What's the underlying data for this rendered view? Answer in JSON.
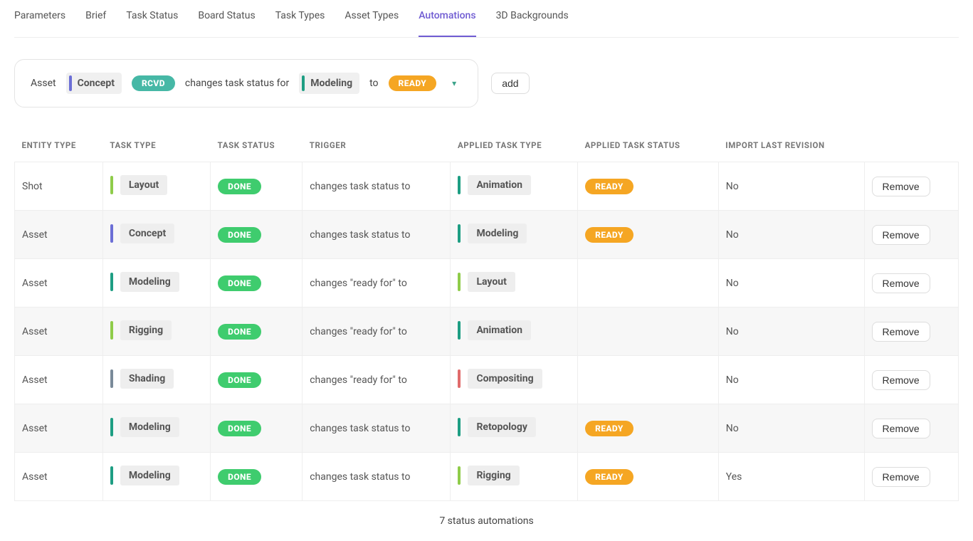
{
  "tabs": [
    {
      "label": "Parameters",
      "active": false
    },
    {
      "label": "Brief",
      "active": false
    },
    {
      "label": "Task Status",
      "active": false
    },
    {
      "label": "Board Status",
      "active": false
    },
    {
      "label": "Task Types",
      "active": false
    },
    {
      "label": "Asset Types",
      "active": false
    },
    {
      "label": "Automations",
      "active": true
    },
    {
      "label": "3D Backgrounds",
      "active": false
    }
  ],
  "builder": {
    "entity": "Asset",
    "task_type": {
      "label": "Concept",
      "color": "#6c6fd6"
    },
    "task_status": {
      "label": "RCVD",
      "color": "#46b8a6"
    },
    "mid_text": "changes task status for",
    "applied_task_type": {
      "label": "Modeling",
      "color": "#1e9e83"
    },
    "to_text": "to",
    "applied_task_status": {
      "label": "READY",
      "color": "#f5a623"
    },
    "add_label": "add"
  },
  "columns": {
    "entity": "ENTITY TYPE",
    "task_type": "TASK TYPE",
    "task_status": "TASK STATUS",
    "trigger": "TRIGGER",
    "applied_task_type": "APPLIED TASK TYPE",
    "applied_task_status": "APPLIED TASK STATUS",
    "import_last": "IMPORT LAST REVISION",
    "actions": ""
  },
  "rows": [
    {
      "entity": "Shot",
      "task_type": {
        "label": "Layout",
        "color": "#8fcc4a"
      },
      "tt_color": "#8fcc4a",
      "task_status": {
        "label": "DONE",
        "color": "#3fcc6e"
      },
      "trigger": "changes task status to",
      "applied_task_type": {
        "label": "Animation",
        "color": "#1e9e83"
      },
      "att_color": "#1e9e83",
      "applied_task_status": {
        "label": "READY",
        "color": "#f5a623"
      },
      "import_last": "No",
      "remove": "Remove"
    },
    {
      "entity": "Asset",
      "task_type": {
        "label": "Concept"
      },
      "tt_color": "#6c6fd6",
      "task_status": {
        "label": "DONE",
        "color": "#3fcc6e"
      },
      "trigger": "changes task status to",
      "applied_task_type": {
        "label": "Modeling"
      },
      "att_color": "#1e9e83",
      "applied_task_status": {
        "label": "READY",
        "color": "#f5a623"
      },
      "import_last": "No",
      "remove": "Remove"
    },
    {
      "entity": "Asset",
      "task_type": {
        "label": "Modeling"
      },
      "tt_color": "#1e9e83",
      "task_status": {
        "label": "DONE",
        "color": "#3fcc6e"
      },
      "trigger": "changes \"ready for\" to",
      "applied_task_type": {
        "label": "Layout"
      },
      "att_color": "#8fcc4a",
      "applied_task_status": null,
      "import_last": "No",
      "remove": "Remove"
    },
    {
      "entity": "Asset",
      "task_type": {
        "label": "Rigging"
      },
      "tt_color": "#8fcc4a",
      "task_status": {
        "label": "DONE",
        "color": "#3fcc6e"
      },
      "trigger": "changes \"ready for\" to",
      "applied_task_type": {
        "label": "Animation"
      },
      "att_color": "#1e9e83",
      "applied_task_status": null,
      "import_last": "No",
      "remove": "Remove"
    },
    {
      "entity": "Asset",
      "task_type": {
        "label": "Shading"
      },
      "tt_color": "#7a8a99",
      "task_status": {
        "label": "DONE",
        "color": "#3fcc6e"
      },
      "trigger": "changes \"ready for\" to",
      "applied_task_type": {
        "label": "Compositing"
      },
      "att_color": "#e06b6b",
      "applied_task_status": null,
      "import_last": "No",
      "remove": "Remove"
    },
    {
      "entity": "Asset",
      "task_type": {
        "label": "Modeling"
      },
      "tt_color": "#1e9e83",
      "task_status": {
        "label": "DONE",
        "color": "#3fcc6e"
      },
      "trigger": "changes task status to",
      "applied_task_type": {
        "label": "Retopology"
      },
      "att_color": "#1e9e83",
      "applied_task_status": {
        "label": "READY",
        "color": "#f5a623"
      },
      "import_last": "No",
      "remove": "Remove"
    },
    {
      "entity": "Asset",
      "task_type": {
        "label": "Modeling"
      },
      "tt_color": "#1e9e83",
      "task_status": {
        "label": "DONE",
        "color": "#3fcc6e"
      },
      "trigger": "changes task status to",
      "applied_task_type": {
        "label": "Rigging"
      },
      "att_color": "#8fcc4a",
      "applied_task_status": {
        "label": "READY",
        "color": "#f5a623"
      },
      "import_last": "Yes",
      "remove": "Remove"
    }
  ],
  "footer": "7 status automations"
}
